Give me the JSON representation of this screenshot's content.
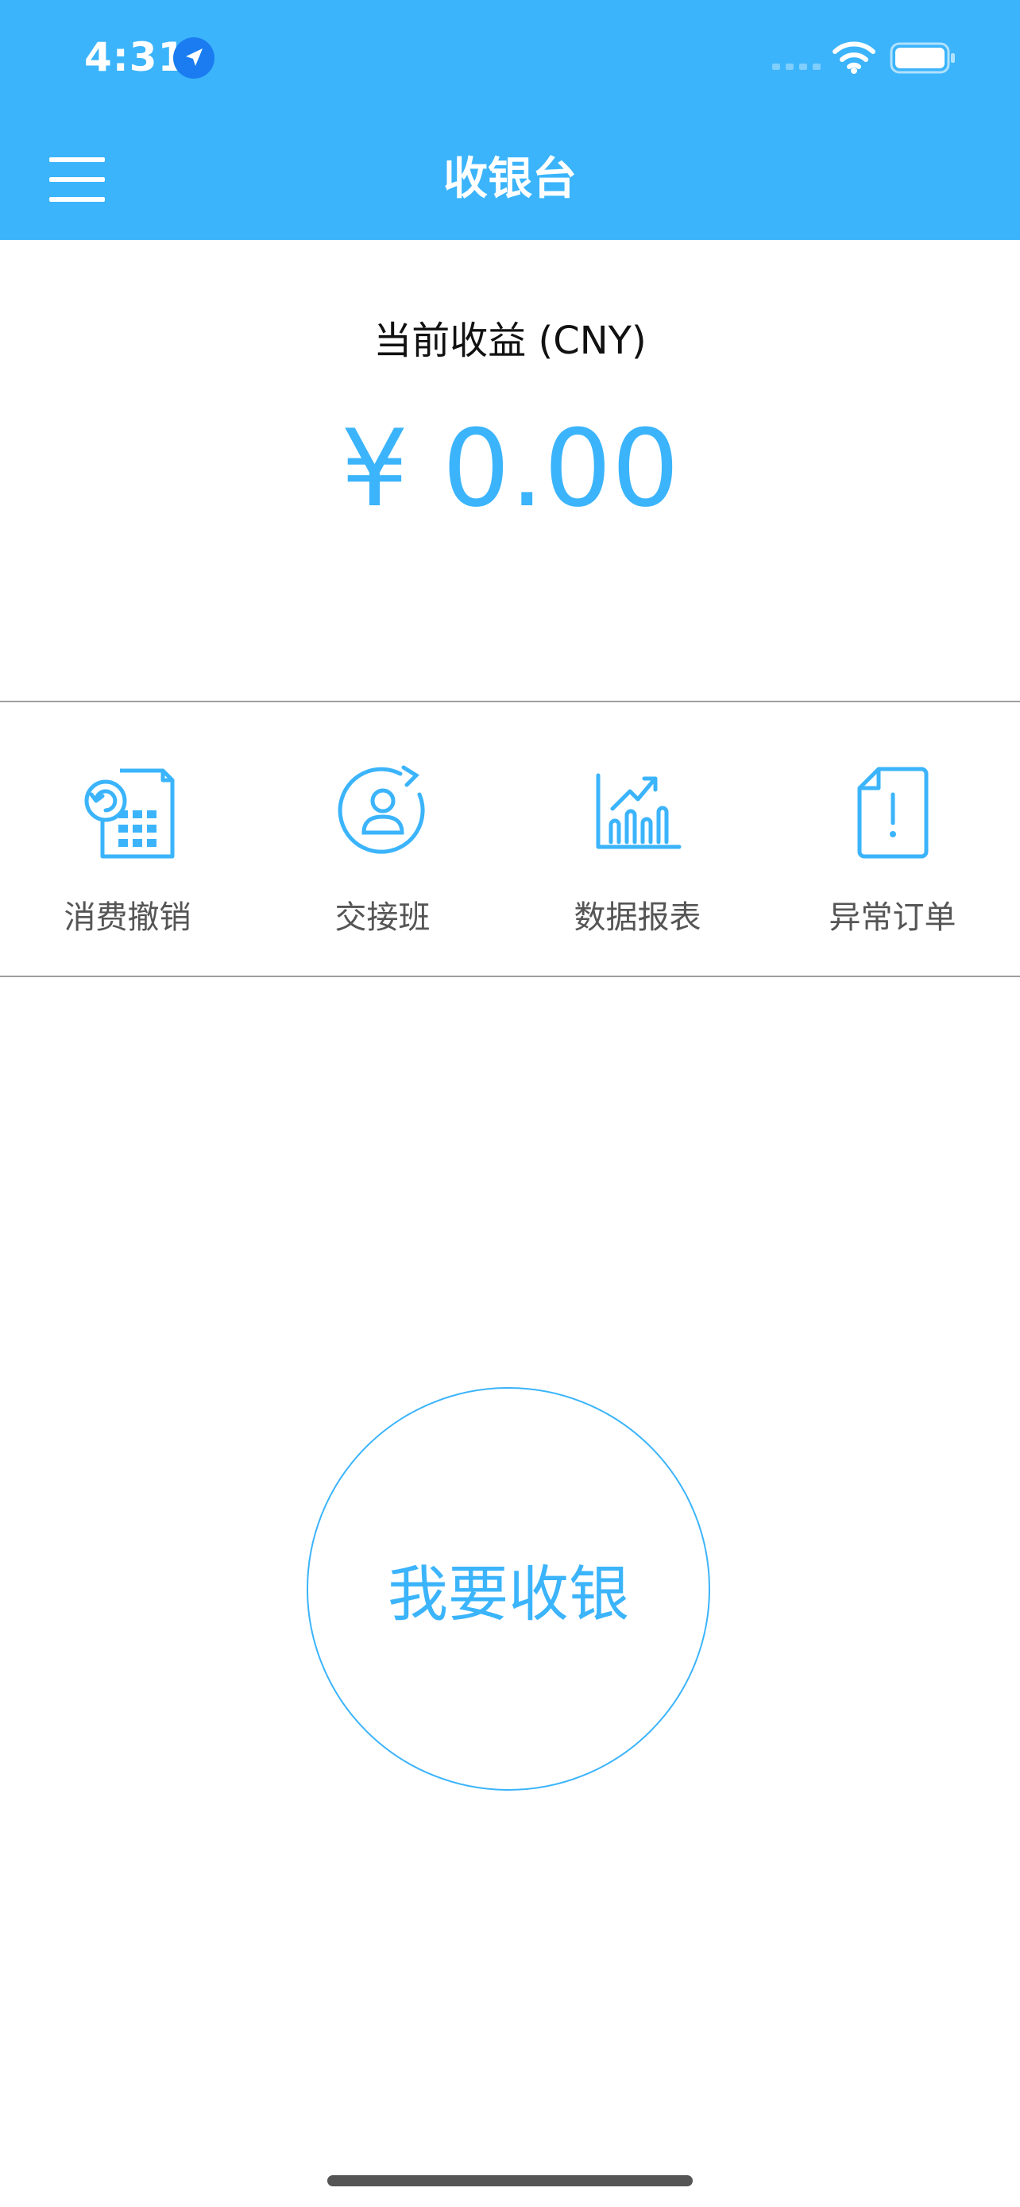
{
  "status_bar": {
    "time": "4:31"
  },
  "header": {
    "title": "收银台"
  },
  "earnings": {
    "label": "当前收益 (CNY)",
    "amount": "¥ 0.00"
  },
  "quick_actions": [
    {
      "label": "消费撤销",
      "icon": "receipt-undo-icon"
    },
    {
      "label": "交接班",
      "icon": "user-rotate-icon"
    },
    {
      "label": "数据报表",
      "icon": "bar-chart-icon"
    },
    {
      "label": "异常订单",
      "icon": "document-alert-icon"
    }
  ],
  "cashier": {
    "label": "我要收银"
  },
  "colors": {
    "accent": "#3bb4fb",
    "text_muted": "#555555",
    "divider": "#9e9e9e"
  }
}
